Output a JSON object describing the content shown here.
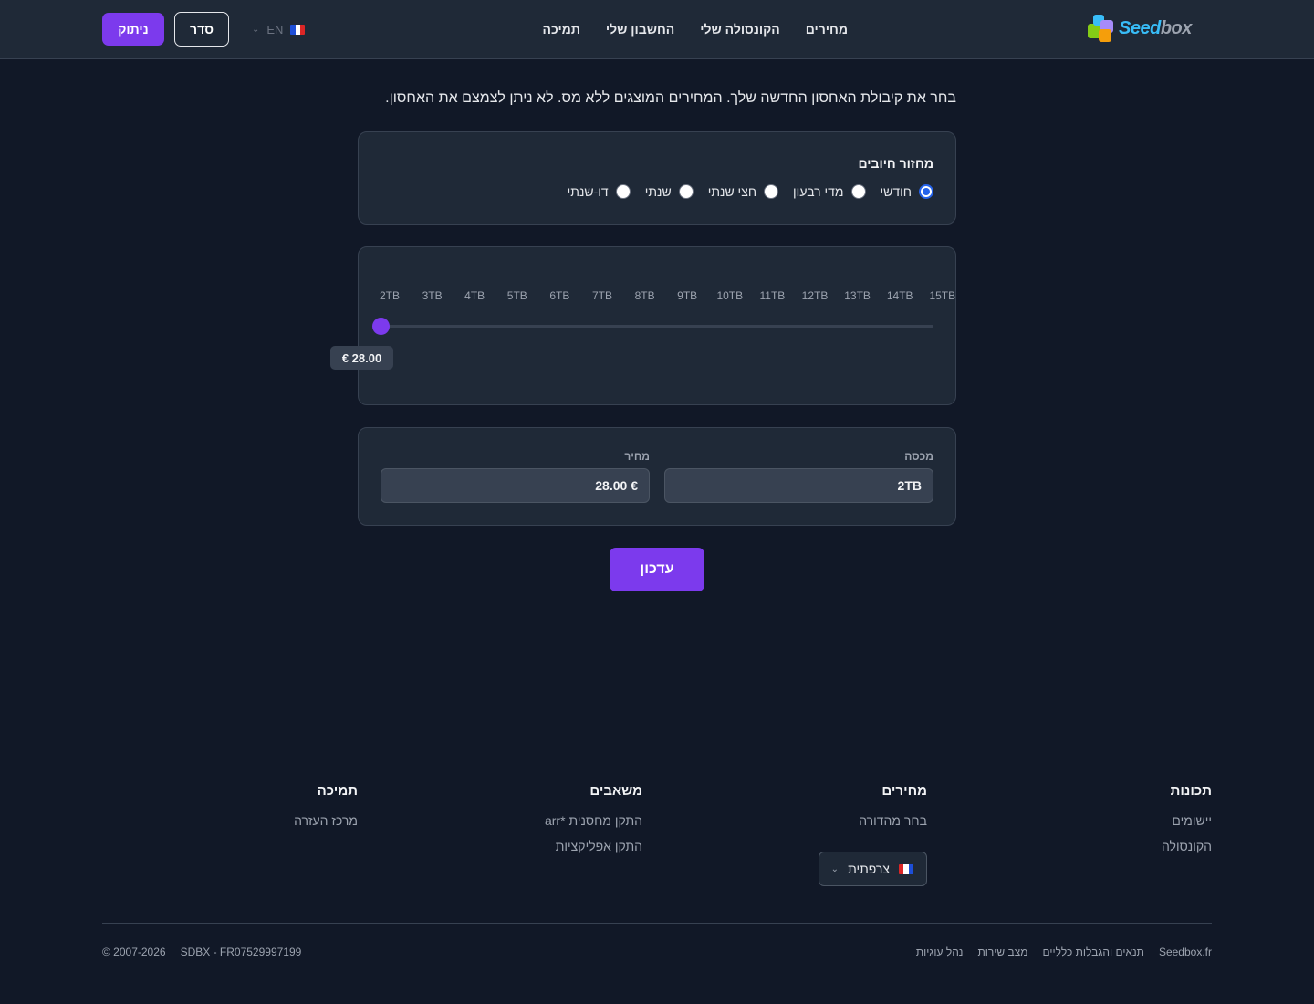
{
  "header": {
    "logo_text_a": "Seed",
    "logo_text_b": "box",
    "nav": [
      "מחירים",
      "הקונסולה שלי",
      "החשבון שלי",
      "תמיכה"
    ],
    "lang_code": "EN",
    "order_button": "סדר",
    "logout_button": "ניתוק"
  },
  "intro": "בחר את קיבולת האחסון החדשה שלך. המחירים המוצגים ללא מס. לא ניתן לצמצם את האחסון.",
  "billing": {
    "title": "מחזור חיובים",
    "options": [
      {
        "label": "חודשי",
        "checked": true
      },
      {
        "label": "מדי רבעון",
        "checked": false
      },
      {
        "label": "חצי שנתי",
        "checked": false
      },
      {
        "label": "שנתי",
        "checked": false
      },
      {
        "label": "דו-שנתי",
        "checked": false
      }
    ]
  },
  "slider": {
    "ticks": [
      "2TB",
      "3TB",
      "4TB",
      "5TB",
      "6TB",
      "7TB",
      "8TB",
      "9TB",
      "10TB",
      "11TB",
      "12TB",
      "13TB",
      "14TB",
      "15TB"
    ],
    "selected": "2TB",
    "price_tooltip": "€ 28.00"
  },
  "summary": {
    "quota_label": "מכסה",
    "quota_value": "2TB",
    "price_label": "מחיר",
    "price_value": "€ 28.00"
  },
  "update_button": "עדכון",
  "footer": {
    "columns": [
      {
        "title": "תכונות",
        "links": [
          "יישומים",
          "הקונסולה"
        ]
      },
      {
        "title": "מחירים",
        "links": [
          "בחר מהדורה"
        ]
      },
      {
        "title": "משאבים",
        "links": [
          "התקן מחסנית *arr",
          "התקן אפליקציות"
        ]
      },
      {
        "title": "תמיכה",
        "links": [
          "מרכז העזרה"
        ]
      }
    ],
    "language_select": "צרפתית",
    "legal_links": [
      "Seedbox.fr",
      "תנאים והגבלות כלליים",
      "מצב שירות",
      "נהל עוגיות"
    ],
    "copyright": "© 2007-2026",
    "company_id": "SDBX - FR07529997199"
  },
  "colors": {
    "accent": "#7c3aed",
    "background": "#111827",
    "card": "#1f2937",
    "radio_checked": "#2563eb"
  },
  "icons": {
    "flag": "france-flag-icon",
    "chevron": "chevron-down-icon"
  }
}
